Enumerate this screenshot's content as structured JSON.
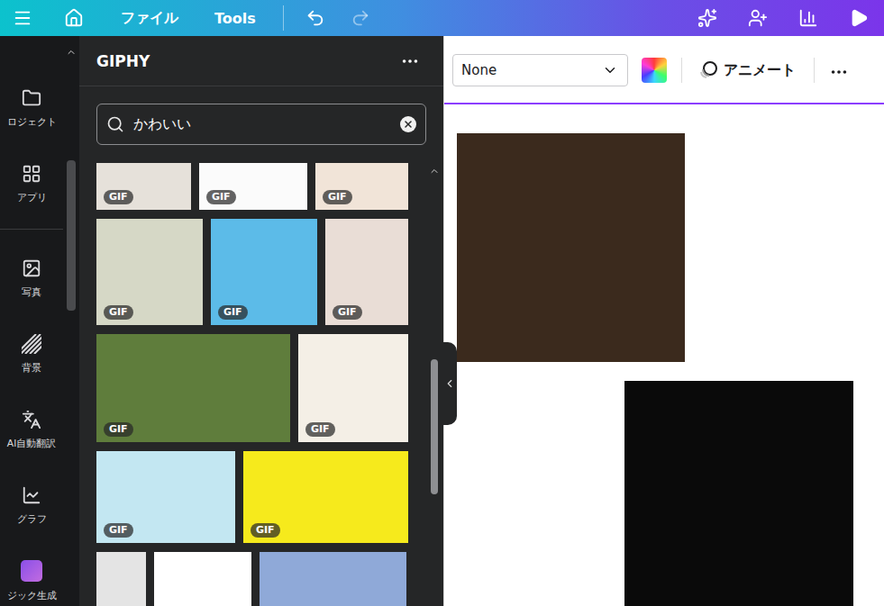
{
  "topbar": {
    "menu": [
      {
        "label": "ファイル"
      },
      {
        "label": "Tools"
      }
    ],
    "undo": {
      "disabled": false
    },
    "redo": {
      "disabled": true
    }
  },
  "sidebar": {
    "items": [
      {
        "label": "ロジェクト"
      },
      {
        "label": "アプリ"
      },
      {
        "label": "写真"
      },
      {
        "label": "背景"
      },
      {
        "label": "AI自動翻訳"
      },
      {
        "label": "グラフ"
      },
      {
        "label": "ジック生成"
      }
    ]
  },
  "panel": {
    "title": "GIPHY",
    "search": {
      "value": "かわいい"
    },
    "gif_rows": [
      {
        "tiles": [
          {
            "badge": "GIF",
            "color": "#e6e1da"
          },
          {
            "badge": "GIF",
            "color": "#fbfbfb"
          },
          {
            "badge": "GIF",
            "color": "#f1e4d8"
          }
        ]
      },
      {
        "tiles": [
          {
            "badge": "GIF",
            "color": "#d6d8c6"
          },
          {
            "badge": "GIF",
            "color": "#5cbbe8"
          },
          {
            "badge": "GIF",
            "color": "#e9ddd6"
          }
        ]
      },
      {
        "tiles": [
          {
            "badge": "GIF",
            "color": "#5f7d3c"
          },
          {
            "badge": "GIF",
            "color": "#f4efe6"
          }
        ]
      },
      {
        "tiles": [
          {
            "badge": "GIF",
            "color": "#c3e7f2"
          },
          {
            "badge": "GIF",
            "color": "#f6ea1c"
          }
        ]
      },
      {
        "tiles": [
          {
            "color": "#e4e4e4"
          },
          {
            "color": "#ffffff"
          },
          {
            "color": "#8fa9d8"
          }
        ]
      }
    ]
  },
  "toolbar": {
    "dropdown": "None",
    "animate": "アニメート"
  },
  "canvas": {
    "items": [
      {
        "kind": "gif",
        "color": "#3b2a1d"
      },
      {
        "kind": "gif",
        "color": "#0a0a0a"
      }
    ]
  }
}
